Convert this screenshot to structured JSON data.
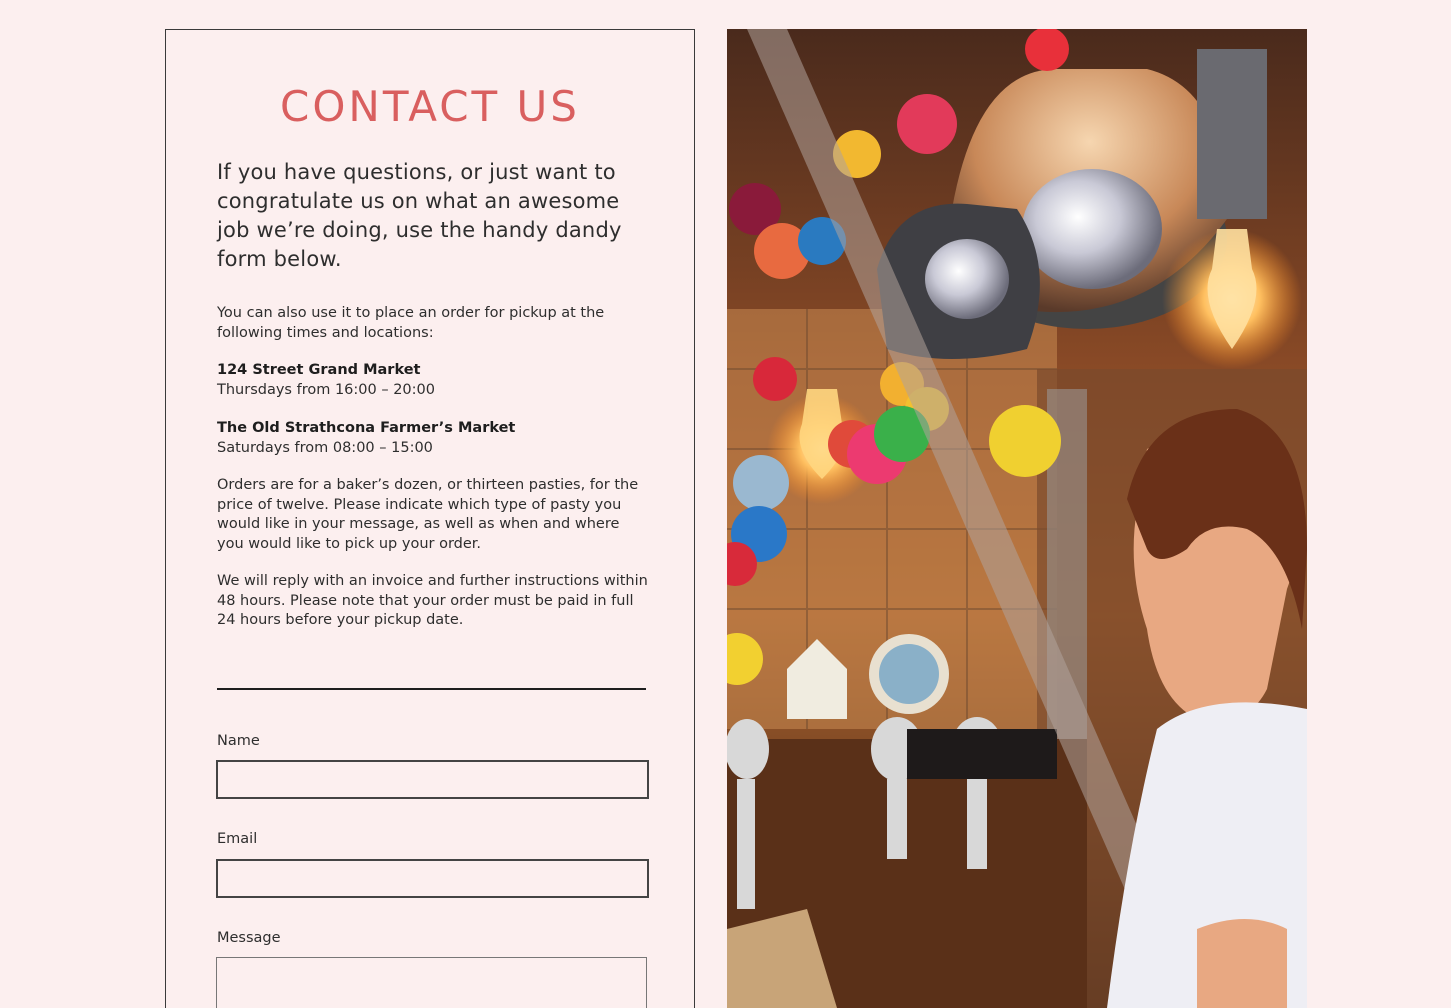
{
  "contact": {
    "title": "CONTACT US",
    "intro": "If you have questions, or just want to congratulate us on what an awesome job we’re doing, use the handy dandy form below.",
    "order_info": "You can also use it to place an order for pickup at the following times and locations:",
    "locations": [
      {
        "name": "124 Street Grand Market",
        "time": "Thursdays from 16:00 – 20:00"
      },
      {
        "name": "The Old Strathcona Farmer’s Market",
        "time": "Saturdays from 08:00 – 15:00"
      }
    ],
    "orders_note": "Orders are for a baker’s dozen, or thirteen pasties, for the price of twelve. Please indicate which type of pasty you would like in your message, as well as when and where you would like to pick up your order.",
    "reply_note": "We will reply with an invoice and further instructions within 48 hours. Please note that your order must be paid in full 24 hours before your pickup date."
  },
  "form": {
    "name_label": "Name",
    "name_value": "",
    "email_label": "Email",
    "email_value": "",
    "message_label": "Message",
    "message_value": ""
  },
  "colors": {
    "background": "#fcefef",
    "accent": "#d95f5f",
    "text": "#2e2e2e"
  }
}
